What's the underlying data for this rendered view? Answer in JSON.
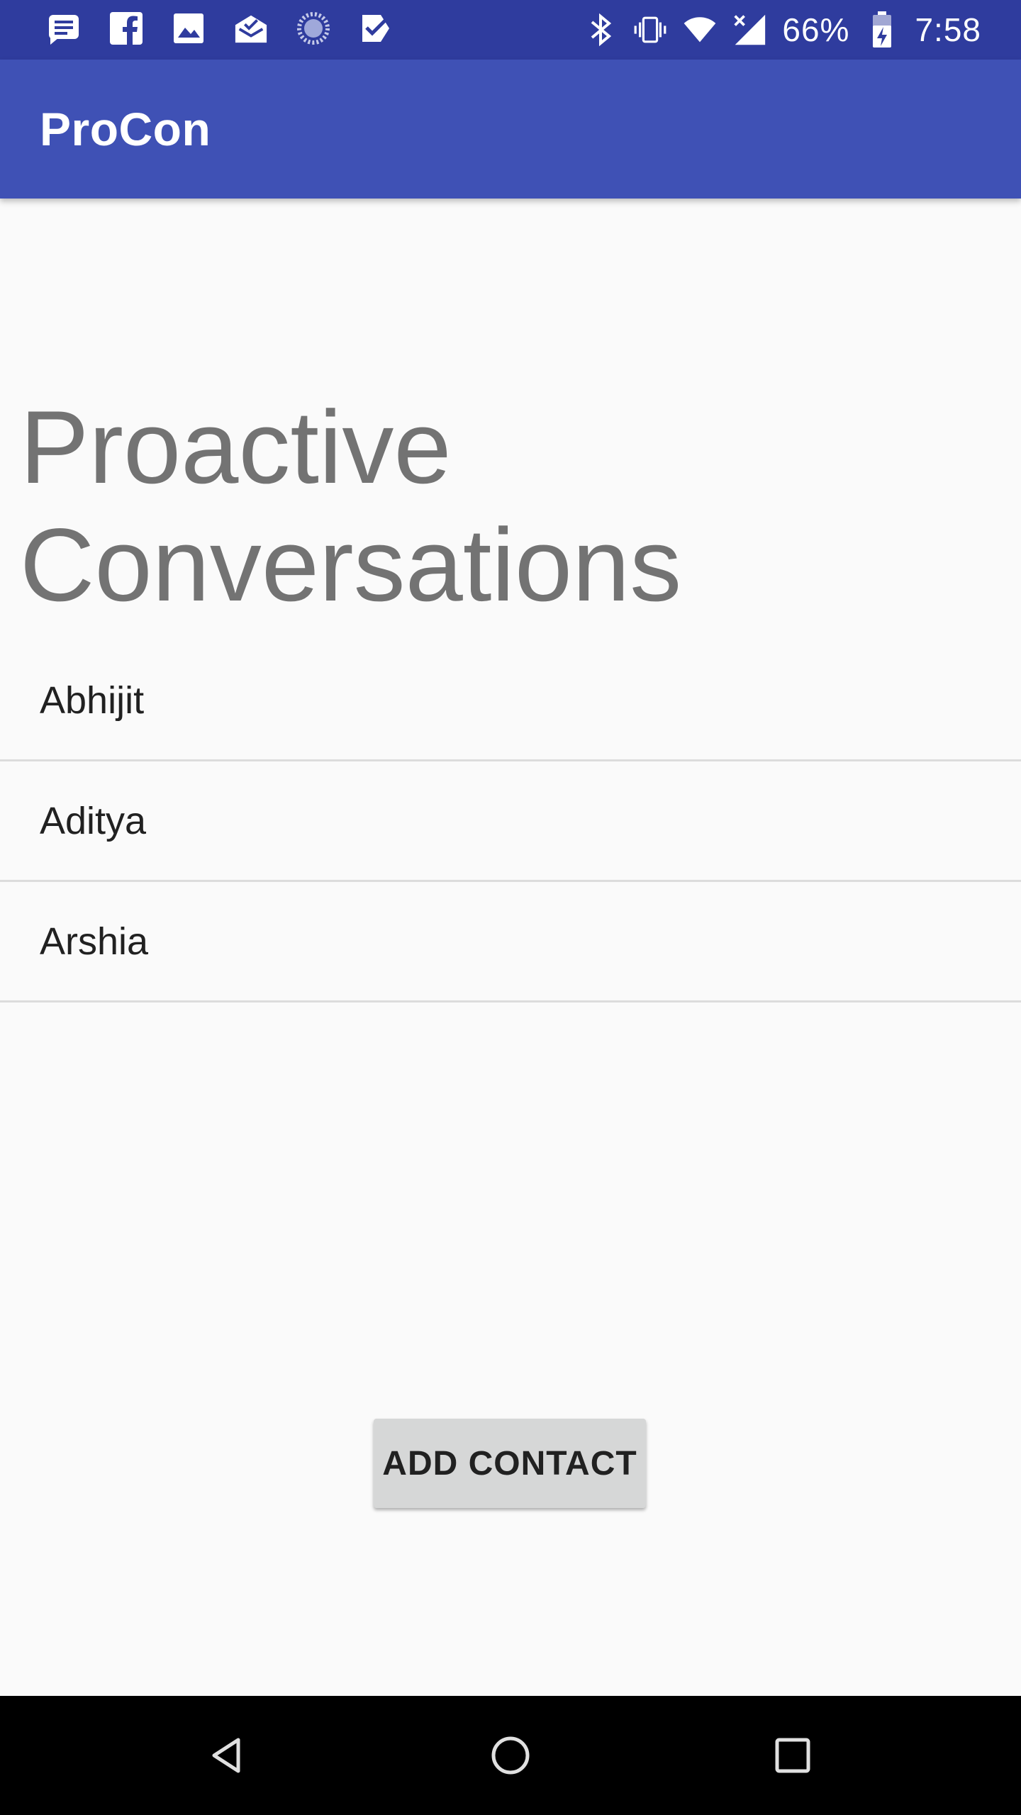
{
  "status_bar": {
    "battery_percent": "66%",
    "time": "7:58",
    "left_icons": [
      "message-icon",
      "facebook-icon",
      "image-icon",
      "mail-icon",
      "loading-icon",
      "check-icon"
    ],
    "right_icons": [
      "bluetooth-icon",
      "vibrate-icon",
      "wifi-icon",
      "signal-icon",
      "battery-icon"
    ]
  },
  "app_bar": {
    "title": "ProCon"
  },
  "main": {
    "heading_line1": "Proactive",
    "heading_line2": "Conversations",
    "contacts": [
      {
        "name": "Abhijit"
      },
      {
        "name": "Aditya"
      },
      {
        "name": "Arshia"
      }
    ],
    "add_button_label": "ADD CONTACT"
  },
  "nav_bar": {
    "buttons": [
      "back-icon",
      "home-icon",
      "recents-icon"
    ]
  },
  "colors": {
    "status_bar": "#2f3c9e",
    "app_bar": "#3f51b5",
    "background": "#fafafa",
    "heading_text": "#737373",
    "button_bg": "#d6d7d7"
  }
}
